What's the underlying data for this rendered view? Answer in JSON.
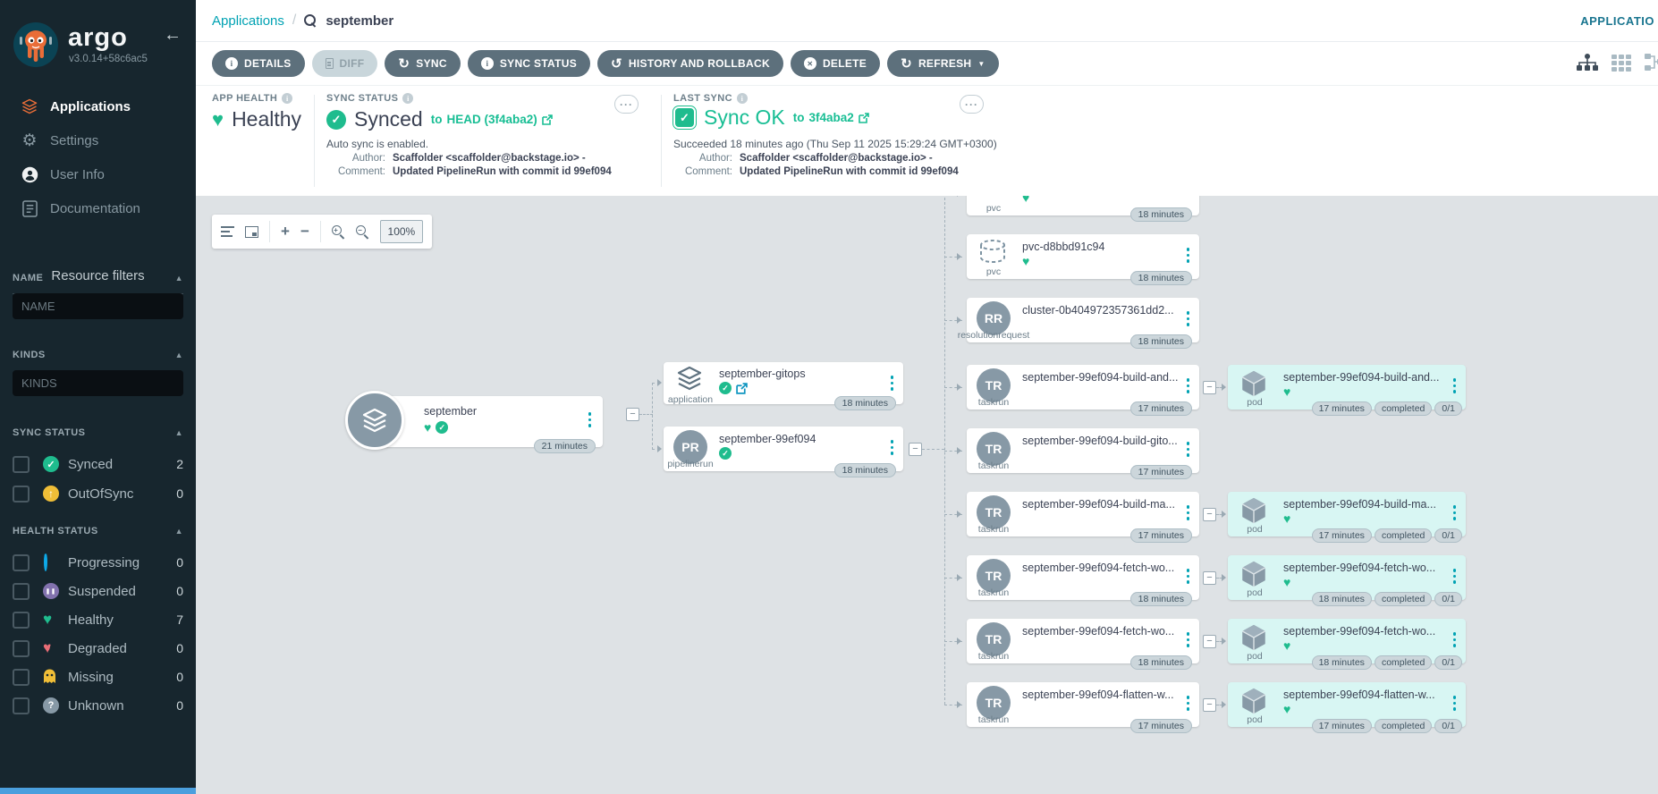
{
  "colors": {
    "accent_teal": "#00A2B3",
    "success_green": "#1FBC8E",
    "link_green": "#18BE94",
    "warning_yellow": "#F0BE37",
    "progress_blue": "#0DAAE9",
    "suspended_purple": "#8272AE",
    "degraded_red": "#E96D76",
    "button_slate": "#5D707C",
    "sidebar_bg": "#17262E",
    "graph_bg": "#DEE2E5",
    "pod_bg": "#D8F6F3"
  },
  "sidebar": {
    "brand": "argo",
    "version": "v3.0.14+58c6ac5",
    "nav": [
      {
        "label": "Applications"
      },
      {
        "label": "Settings"
      },
      {
        "label": "User Info"
      },
      {
        "label": "Documentation"
      }
    ],
    "filters_title": "Resource filters",
    "filter_name": {
      "label": "NAME",
      "placeholder": "NAME"
    },
    "filter_kinds": {
      "label": "KINDS",
      "placeholder": "KINDS"
    },
    "sync_section": {
      "label": "SYNC STATUS",
      "items": [
        {
          "label": "Synced",
          "count": "2"
        },
        {
          "label": "OutOfSync",
          "count": "0"
        }
      ]
    },
    "health_section": {
      "label": "HEALTH STATUS",
      "items": [
        {
          "label": "Progressing",
          "count": "0"
        },
        {
          "label": "Suspended",
          "count": "0"
        },
        {
          "label": "Healthy",
          "count": "7"
        },
        {
          "label": "Degraded",
          "count": "0"
        },
        {
          "label": "Missing",
          "count": "0"
        },
        {
          "label": "Unknown",
          "count": "0"
        }
      ]
    }
  },
  "header": {
    "breadcrumb_root": "Applications",
    "breadcrumb_sep": "/",
    "search_value": "september",
    "right_label": "APPLICATIO"
  },
  "toolbar": {
    "buttons": [
      {
        "label": "DETAILS"
      },
      {
        "label": "DIFF"
      },
      {
        "label": "SYNC"
      },
      {
        "label": "SYNC STATUS"
      },
      {
        "label": "HISTORY AND ROLLBACK"
      },
      {
        "label": "DELETE"
      },
      {
        "label": "REFRESH"
      }
    ]
  },
  "status": {
    "app_health": {
      "label": "APP HEALTH",
      "value": "Healthy"
    },
    "sync": {
      "label": "SYNC STATUS",
      "value": "Synced",
      "to": "to",
      "target": "HEAD (3f4aba2)",
      "note": "Auto sync is enabled.",
      "author_label": "Author:",
      "author": "Scaffolder <scaffolder@backstage.io> -",
      "comment_label": "Comment:",
      "comment": "Updated PipelineRun with commit id 99ef094"
    },
    "last_sync": {
      "label": "LAST SYNC",
      "value": "Sync OK",
      "to": "to",
      "target": "3f4aba2",
      "note": "Succeeded 18 minutes ago (Thu Sep 11 2025 15:29:24 GMT+0300)",
      "author_label": "Author:",
      "author": "Scaffolder <scaffolder@backstage.io> -",
      "comment_label": "Comment:",
      "comment": "Updated PipelineRun with commit id 99ef094"
    }
  },
  "graph": {
    "zoom_value": "100%",
    "root": {
      "name": "september",
      "age": "21 minutes"
    },
    "app_node": {
      "name": "september-gitops",
      "kind": "application",
      "age": "18 minutes"
    },
    "pipeline_node": {
      "name": "september-99ef094",
      "abbr": "PR",
      "kind": "pipelinerun",
      "age": "18 minutes"
    },
    "pvc_partial": {
      "kind": "pvc",
      "age": "18 minutes"
    },
    "pvc_node": {
      "name": "pvc-d8bbd91c94",
      "kind": "pvc",
      "age": "18 minutes"
    },
    "rr_node": {
      "name": "cluster-0b404972357361dd2...",
      "abbr": "RR",
      "kind": "resolutionrequest",
      "age": "18 minutes"
    },
    "taskrun_kind": "taskrun",
    "taskrun_abbr": "TR",
    "pod_kind": "pod",
    "taskruns": [
      {
        "name": "september-99ef094-build-and...",
        "age": "17 minutes",
        "pod_name": "september-99ef094-build-and...",
        "pod_age": "17 minutes",
        "pod_status": "completed",
        "pod_ready": "0/1"
      },
      {
        "name": "september-99ef094-build-gito...",
        "age": "17 minutes"
      },
      {
        "name": "september-99ef094-build-ma...",
        "age": "17 minutes",
        "pod_name": "september-99ef094-build-ma...",
        "pod_age": "17 minutes",
        "pod_status": "completed",
        "pod_ready": "0/1"
      },
      {
        "name": "september-99ef094-fetch-wo...",
        "age": "18 minutes",
        "pod_name": "september-99ef094-fetch-wo...",
        "pod_age": "18 minutes",
        "pod_status": "completed",
        "pod_ready": "0/1"
      },
      {
        "name": "september-99ef094-fetch-wo...",
        "age": "18 minutes",
        "pod_name": "september-99ef094-fetch-wo...",
        "pod_age": "18 minutes",
        "pod_status": "completed",
        "pod_ready": "0/1"
      },
      {
        "name": "september-99ef094-flatten-w...",
        "age": "17 minutes",
        "pod_name": "september-99ef094-flatten-w...",
        "pod_age": "17 minutes",
        "pod_status": "completed",
        "pod_ready": "0/1"
      }
    ]
  }
}
